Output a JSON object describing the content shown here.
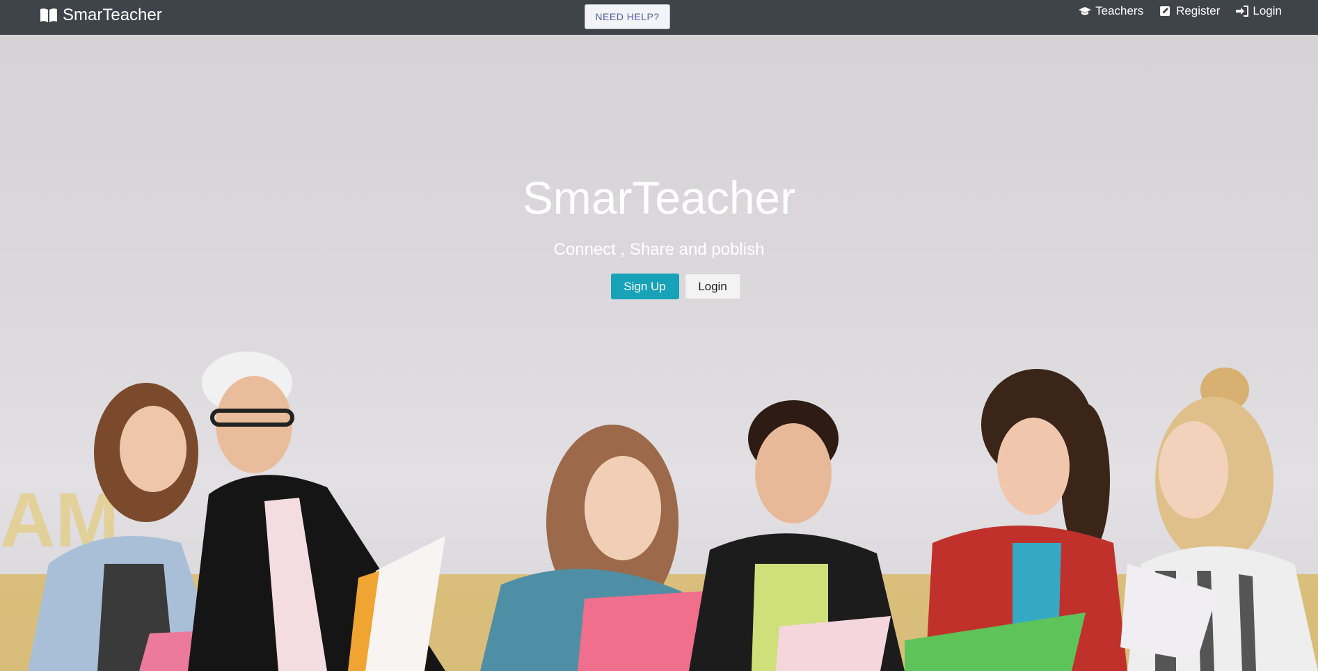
{
  "navbar": {
    "brand": "SmarTeacher",
    "help_label": "NEED HELP?",
    "links": [
      {
        "label": "Teachers",
        "icon": "graduation-cap-icon"
      },
      {
        "label": "Register",
        "icon": "edit-icon"
      },
      {
        "label": "Login",
        "icon": "sign-in-icon"
      }
    ]
  },
  "hero": {
    "title": "SmarTeacher",
    "subtitle": "Connect , Share and poblish",
    "signup_label": "Sign Up",
    "login_label": "Login"
  },
  "colors": {
    "navbar": "#3f444b",
    "signup": "#17a2b8",
    "help_text": "#5560a8"
  }
}
